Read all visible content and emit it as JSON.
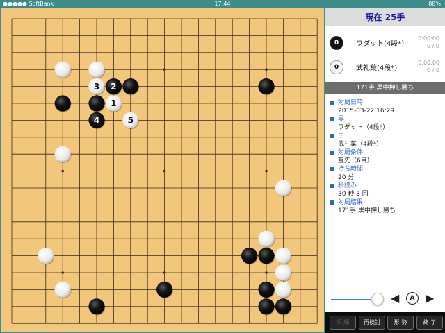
{
  "status_bar": {
    "carrier": "●●●●● SoftBank",
    "time": "17:44",
    "battery": "88%"
  },
  "board": {
    "size": 19,
    "colors": {
      "wood": "#f2c77b",
      "line": "#3a2a18",
      "teal": "#3f8e8e"
    },
    "stones": [
      {
        "col": 3,
        "row": 3,
        "color": "white"
      },
      {
        "col": 5,
        "row": 3,
        "color": "white"
      },
      {
        "col": 5,
        "row": 4,
        "color": "white",
        "label": "3"
      },
      {
        "col": 6,
        "row": 4,
        "color": "black",
        "label": "2"
      },
      {
        "col": 7,
        "row": 4,
        "color": "black"
      },
      {
        "col": 15,
        "row": 4,
        "color": "black"
      },
      {
        "col": 3,
        "row": 5,
        "color": "black"
      },
      {
        "col": 5,
        "row": 5,
        "color": "black"
      },
      {
        "col": 6,
        "row": 5,
        "color": "white",
        "label": "1"
      },
      {
        "col": 5,
        "row": 6,
        "color": "black",
        "label": "4"
      },
      {
        "col": 7,
        "row": 6,
        "color": "white",
        "label": "5"
      },
      {
        "col": 3,
        "row": 8,
        "color": "white"
      },
      {
        "col": 16,
        "row": 10,
        "color": "white"
      },
      {
        "col": 15,
        "row": 13,
        "color": "white"
      },
      {
        "col": 2,
        "row": 14,
        "color": "white"
      },
      {
        "col": 14,
        "row": 14,
        "color": "black"
      },
      {
        "col": 15,
        "row": 14,
        "color": "black"
      },
      {
        "col": 16,
        "row": 14,
        "color": "white"
      },
      {
        "col": 16,
        "row": 15,
        "color": "white"
      },
      {
        "col": 3,
        "row": 16,
        "color": "white"
      },
      {
        "col": 9,
        "row": 16,
        "color": "black"
      },
      {
        "col": 15,
        "row": 16,
        "color": "black"
      },
      {
        "col": 16,
        "row": 16,
        "color": "white"
      },
      {
        "col": 5,
        "row": 17,
        "color": "black"
      },
      {
        "col": 15,
        "row": 17,
        "color": "black"
      },
      {
        "col": 16,
        "row": 17,
        "color": "black"
      }
    ]
  },
  "panel": {
    "move_header": "現在 25手",
    "players": [
      {
        "captures": "0",
        "color": "black",
        "name": "ワダット(4段*)",
        "time": "0:00:00",
        "byo": "0 / 0"
      },
      {
        "captures": "0",
        "color": "white",
        "name": "武礼葉(4段*)",
        "time": "0:00:00",
        "byo": "0 / 0"
      }
    ],
    "result_bar": "171手 黒中押し勝ち",
    "info": [
      {
        "label": "対局日時",
        "value": "2015-03-22 16:29"
      },
      {
        "label": "黒",
        "value": "ワダット（4段*）"
      },
      {
        "label": "白",
        "value": "武礼葉（4段*）"
      },
      {
        "label": "対局条件",
        "value": "互先（6目）"
      },
      {
        "label": "持ち時間",
        "value": "20 分"
      },
      {
        "label": "秒読み",
        "value": "30 秒 3 回"
      },
      {
        "label": "対局結果",
        "value": "171手 黒中押し勝ち"
      }
    ],
    "controls": {
      "prev_glyph": "◀",
      "auto_glyph": "A",
      "next_glyph": "▶",
      "progress": 1.0
    },
    "buttons": {
      "moves": "手 順",
      "review": "再検討",
      "position": "形 勢",
      "end": "終 了"
    }
  }
}
